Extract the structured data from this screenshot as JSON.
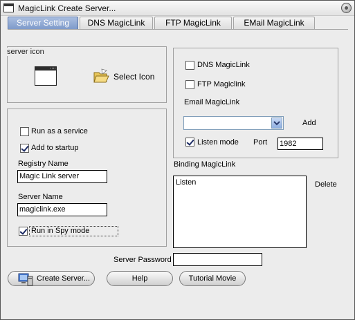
{
  "window": {
    "title": "MagicLink Create Server...",
    "app_icon": "window-app-icon",
    "close_icon": "close-circle-icon"
  },
  "tabs": [
    {
      "label": "Server Setting",
      "active": true
    },
    {
      "label": "DNS MagicLink",
      "active": false
    },
    {
      "label": "FTP MagicLink",
      "active": false
    },
    {
      "label": "EMail MagicLink",
      "active": false
    }
  ],
  "server_icon": {
    "group_label": "server icon",
    "preview_icon": "window-preview-icon",
    "select_icon_label": "Select Icon",
    "select_icon_icon": "folder-open-icon"
  },
  "options": {
    "run_as_service": {
      "label": "Run as a service",
      "checked": false
    },
    "add_to_startup": {
      "label": "Add to startup",
      "checked": true
    },
    "registry_name_label": "Registry Name",
    "registry_name_value": "Magic Link server",
    "server_name_label": "Server Name",
    "server_name_value": "magiclink.exe",
    "spy_mode": {
      "label": "Run in Spy mode",
      "checked": true
    }
  },
  "magiclink": {
    "dns": {
      "label": "DNS MagicLink",
      "checked": false
    },
    "ftp": {
      "label": "FTP Magiclink",
      "checked": false
    },
    "email_label": "Email MagicLink",
    "email_value": "",
    "add_label": "Add",
    "listen_mode": {
      "label": "Listen mode",
      "checked": true
    },
    "port_label": "Port",
    "port_value": "1982"
  },
  "binding": {
    "label": "Binding MagicLink",
    "items": [
      "Listen"
    ],
    "delete_label": "Delete"
  },
  "password": {
    "label": "Server Password",
    "value": ""
  },
  "buttons": {
    "create_server": "Create Server...",
    "create_server_icon": "server-computer-icon",
    "help": "Help",
    "tutorial": "Tutorial Movie"
  }
}
